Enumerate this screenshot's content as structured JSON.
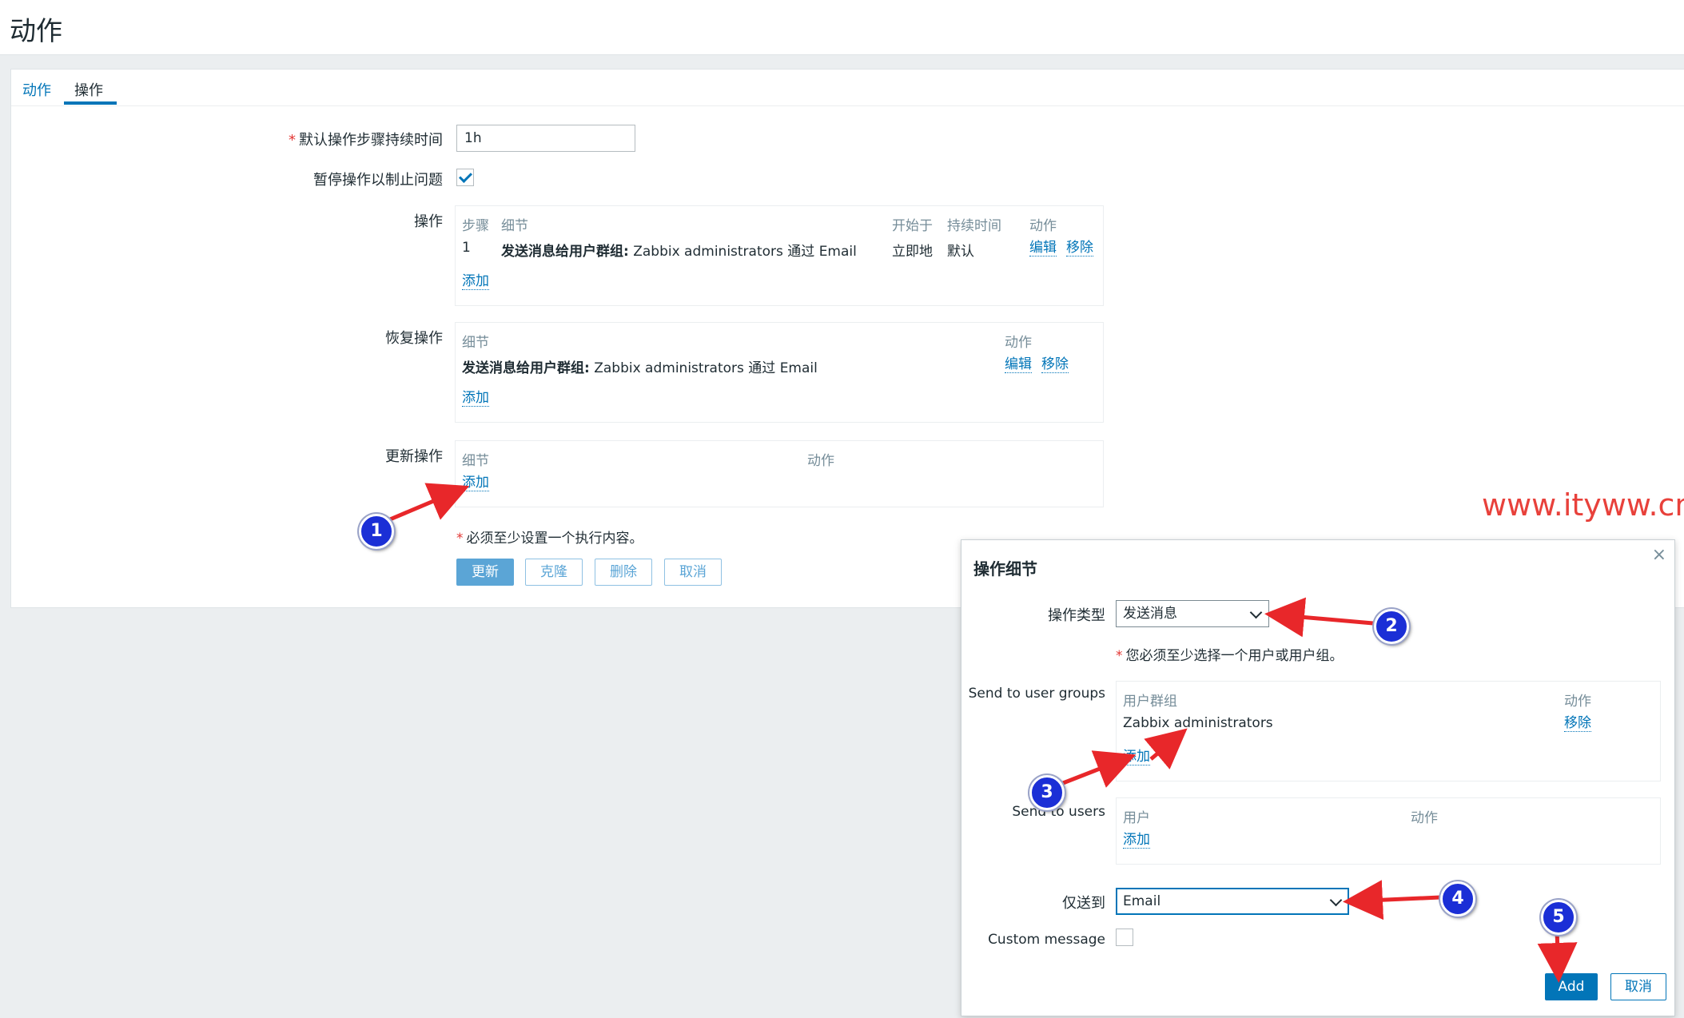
{
  "page": {
    "title": "动作"
  },
  "tabs": [
    {
      "label": "动作",
      "active": false
    },
    {
      "label": "操作",
      "active": true
    }
  ],
  "form": {
    "default_step_duration": {
      "label": "默认操作步骤持续时间",
      "value": "1h"
    },
    "pause_label": "暂停操作以制止问题",
    "pause_checked": true,
    "operations": {
      "label": "操作",
      "headers": {
        "step": "步骤",
        "details": "细节",
        "start_in": "开始于",
        "duration": "持续时间",
        "action": "动作"
      },
      "rows": [
        {
          "step": "1",
          "detail_bold": "发送消息给用户群组:",
          "detail_rest": " Zabbix administrators 通过 Email",
          "start_in": "立即地",
          "duration": "默认",
          "edit": "编辑",
          "remove": "移除"
        }
      ],
      "add": "添加"
    },
    "recovery": {
      "label": "恢复操作",
      "headers": {
        "details": "细节",
        "action": "动作"
      },
      "rows": [
        {
          "detail_bold": "发送消息给用户群组:",
          "detail_rest": " Zabbix administrators 通过 Email",
          "edit": "编辑",
          "remove": "移除"
        }
      ],
      "add": "添加"
    },
    "update": {
      "label": "更新操作",
      "headers": {
        "details": "细节",
        "action": "动作"
      },
      "add": "添加"
    },
    "required_note": "必须至少设置一个执行内容。",
    "buttons": {
      "update": "更新",
      "clone": "克隆",
      "delete": "删除",
      "cancel": "取消"
    }
  },
  "dialog": {
    "title": "操作细节",
    "op_type": {
      "label": "操作类型",
      "value": "发送消息"
    },
    "required_note": "您必须至少选择一个用户或用户组。",
    "user_groups": {
      "label": "Send to user groups",
      "headers": {
        "group": "用户群组",
        "action": "动作"
      },
      "rows": [
        {
          "name": "Zabbix administrators",
          "remove": "移除"
        }
      ],
      "add": "添加"
    },
    "users": {
      "label": "Send to users",
      "headers": {
        "user": "用户",
        "action": "动作"
      },
      "add": "添加"
    },
    "send_only_to": {
      "label": "仅送到",
      "value": "Email"
    },
    "custom_message": {
      "label": "Custom message",
      "checked": false
    },
    "buttons": {
      "add": "Add",
      "cancel": "取消"
    }
  },
  "annotations": {
    "watermark": "www.ityww.cn",
    "badges": [
      "1",
      "2",
      "3",
      "4",
      "5"
    ]
  },
  "colors": {
    "accent": "#0275b8",
    "badge": "#1b2fd6",
    "arrow": "#e8272a",
    "watermark": "#e8413b"
  }
}
